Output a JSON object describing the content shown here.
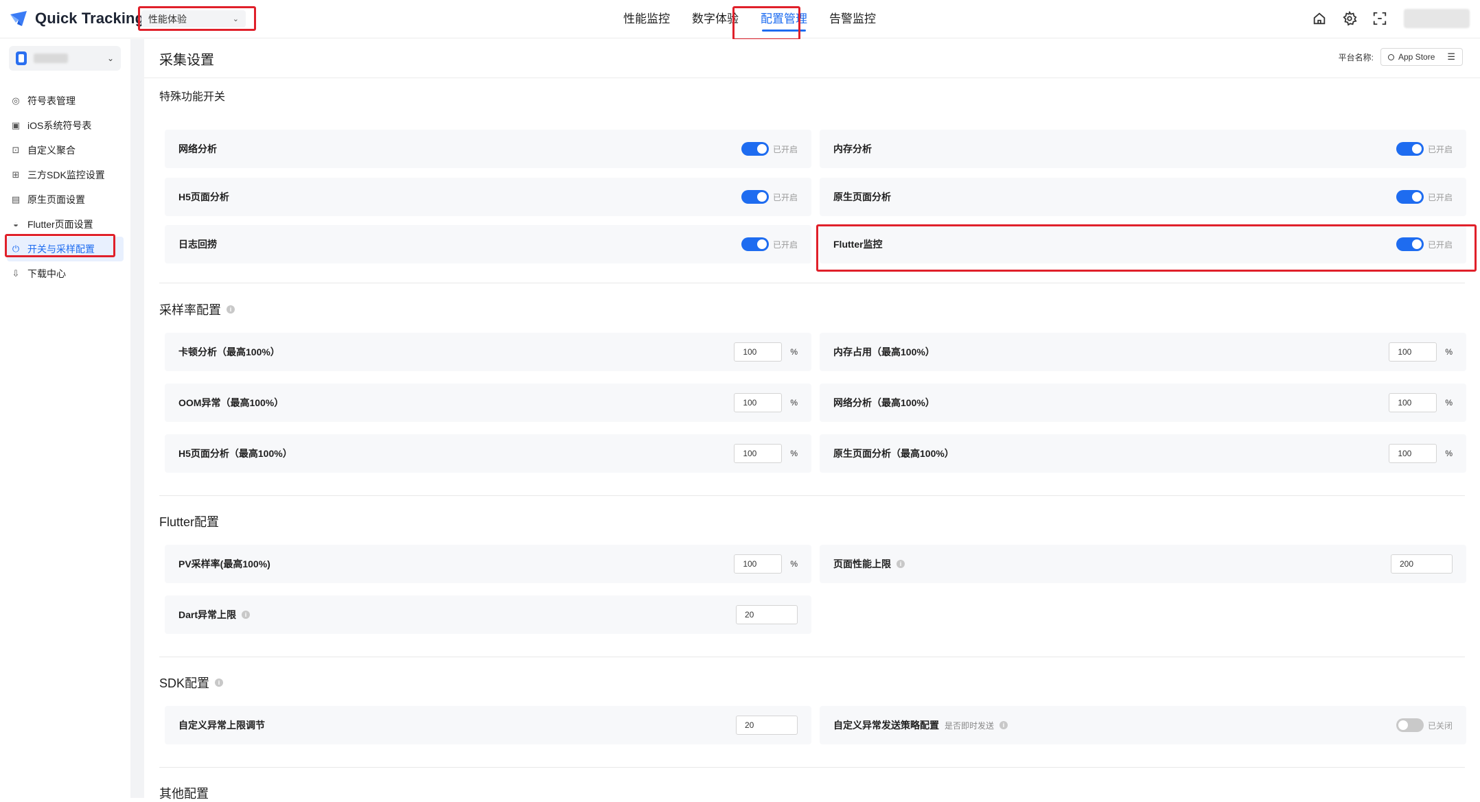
{
  "header": {
    "app_name": "Quick Tracking",
    "product_select": "性能体验",
    "nav": [
      "性能监控",
      "数字体验",
      "配置管理",
      "告警监控"
    ],
    "active_nav_index": 2,
    "icons": [
      "home-icon",
      "gear-icon",
      "scan-icon"
    ],
    "accent_color": "#1e6cf0"
  },
  "sidebar": {
    "items": [
      {
        "label": "符号表管理",
        "icon": "symbol-icon"
      },
      {
        "label": "iOS系统符号表",
        "icon": "ios-symbol-icon"
      },
      {
        "label": "自定义聚合",
        "icon": "aggregate-icon"
      },
      {
        "label": "三方SDK监控设置",
        "icon": "sdk-icon"
      },
      {
        "label": "原生页面设置",
        "icon": "page-icon"
      },
      {
        "label": "Flutter页面设置",
        "icon": "flutter-icon"
      },
      {
        "label": "开关与采样配置",
        "icon": "power-icon"
      },
      {
        "label": "下载中心",
        "icon": "download-icon"
      }
    ],
    "active_index": 6
  },
  "main": {
    "title": "采集设置",
    "platform_label": "平台名称:",
    "platform_value": "App Store",
    "special": {
      "title": "特殊功能开关",
      "items": [
        {
          "label": "网络分析",
          "status": "已开启"
        },
        {
          "label": "内存分析",
          "status": "已开启"
        },
        {
          "label": "H5页面分析",
          "status": "已开启"
        },
        {
          "label": "原生页面分析",
          "status": "已开启"
        },
        {
          "label": "日志回捞",
          "status": "已开启"
        },
        {
          "label": "Flutter监控",
          "status": "已开启"
        }
      ]
    },
    "sampling": {
      "title": "采样率配置",
      "unit": "%",
      "items": [
        {
          "label": "卡顿分析（最高100%）",
          "value": "100"
        },
        {
          "label": "内存占用（最高100%）",
          "value": "100"
        },
        {
          "label": "OOM异常（最高100%）",
          "value": "100"
        },
        {
          "label": "网络分析（最高100%）",
          "value": "100"
        },
        {
          "label": "H5页面分析（最高100%）",
          "value": "100"
        },
        {
          "label": "原生页面分析（最高100%）",
          "value": "100"
        }
      ]
    },
    "flutter": {
      "title": "Flutter配置",
      "pv_label": "PV采样率(最高100%)",
      "pv_value": "100",
      "perf_label": "页面性能上限",
      "perf_value": "200",
      "dart_label": "Dart异常上限",
      "dart_value": "20"
    },
    "sdk": {
      "title": "SDK配置",
      "limit_label": "自定义异常上限调节",
      "limit_value": "20",
      "strategy_label": "自定义异常发送策略配置",
      "strategy_sub": "是否即时发送",
      "strategy_status": "已关闭"
    },
    "other_title": "其他配置"
  }
}
